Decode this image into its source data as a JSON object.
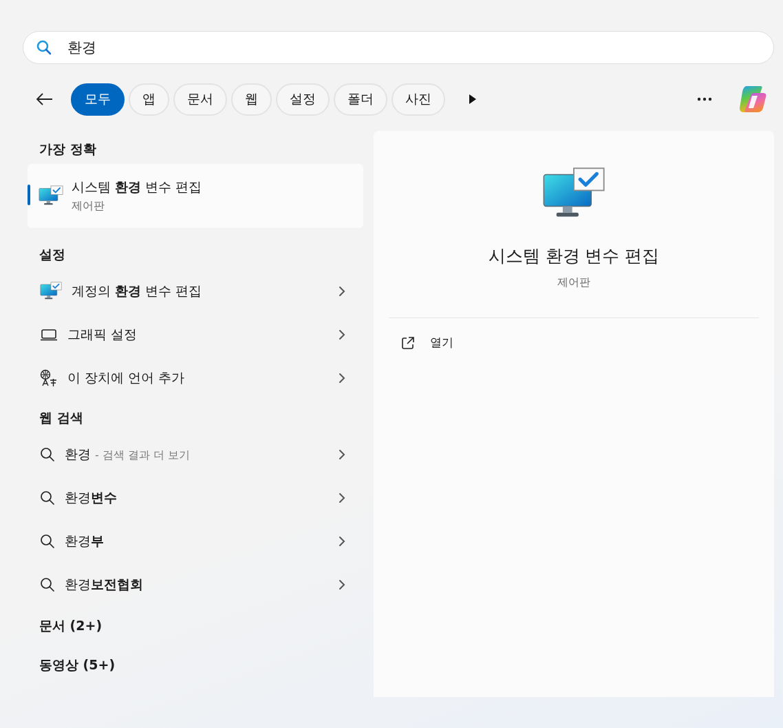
{
  "search": {
    "value": "환경"
  },
  "filters": [
    {
      "label": "모두",
      "selected": true
    },
    {
      "label": "앱",
      "selected": false
    },
    {
      "label": "문서",
      "selected": false
    },
    {
      "label": "웹",
      "selected": false
    },
    {
      "label": "설정",
      "selected": false
    },
    {
      "label": "폴더",
      "selected": false
    },
    {
      "label": "사진",
      "selected": false
    }
  ],
  "best_match": {
    "heading": "가장 정확",
    "title": "시스템 **환경** 변수 편집",
    "subtitle": "제어판",
    "selected": true
  },
  "sections": [
    {
      "heading": "설정",
      "items": [
        {
          "kind": "monitor",
          "label": "계정의 **환경** 변수 편집"
        },
        {
          "kind": "laptop",
          "label": "그래픽 설정"
        },
        {
          "kind": "language",
          "label": "이 장치에 언어 추가"
        }
      ]
    },
    {
      "heading": "웹 검색",
      "items": [
        {
          "kind": "search",
          "label": "환경",
          "hint": "- 검색 결과 더 보기"
        },
        {
          "kind": "search",
          "label": "환경**변수**"
        },
        {
          "kind": "search",
          "label": "환경**부**"
        },
        {
          "kind": "search",
          "label": "환경**보전협회**"
        }
      ]
    }
  ],
  "more_categories": [
    "문서 (2+)",
    "동영상 (5+)"
  ],
  "preview": {
    "title": "시스템 환경 변수 편집",
    "subtitle": "제어판",
    "actions": [
      {
        "label": "열기"
      }
    ]
  }
}
